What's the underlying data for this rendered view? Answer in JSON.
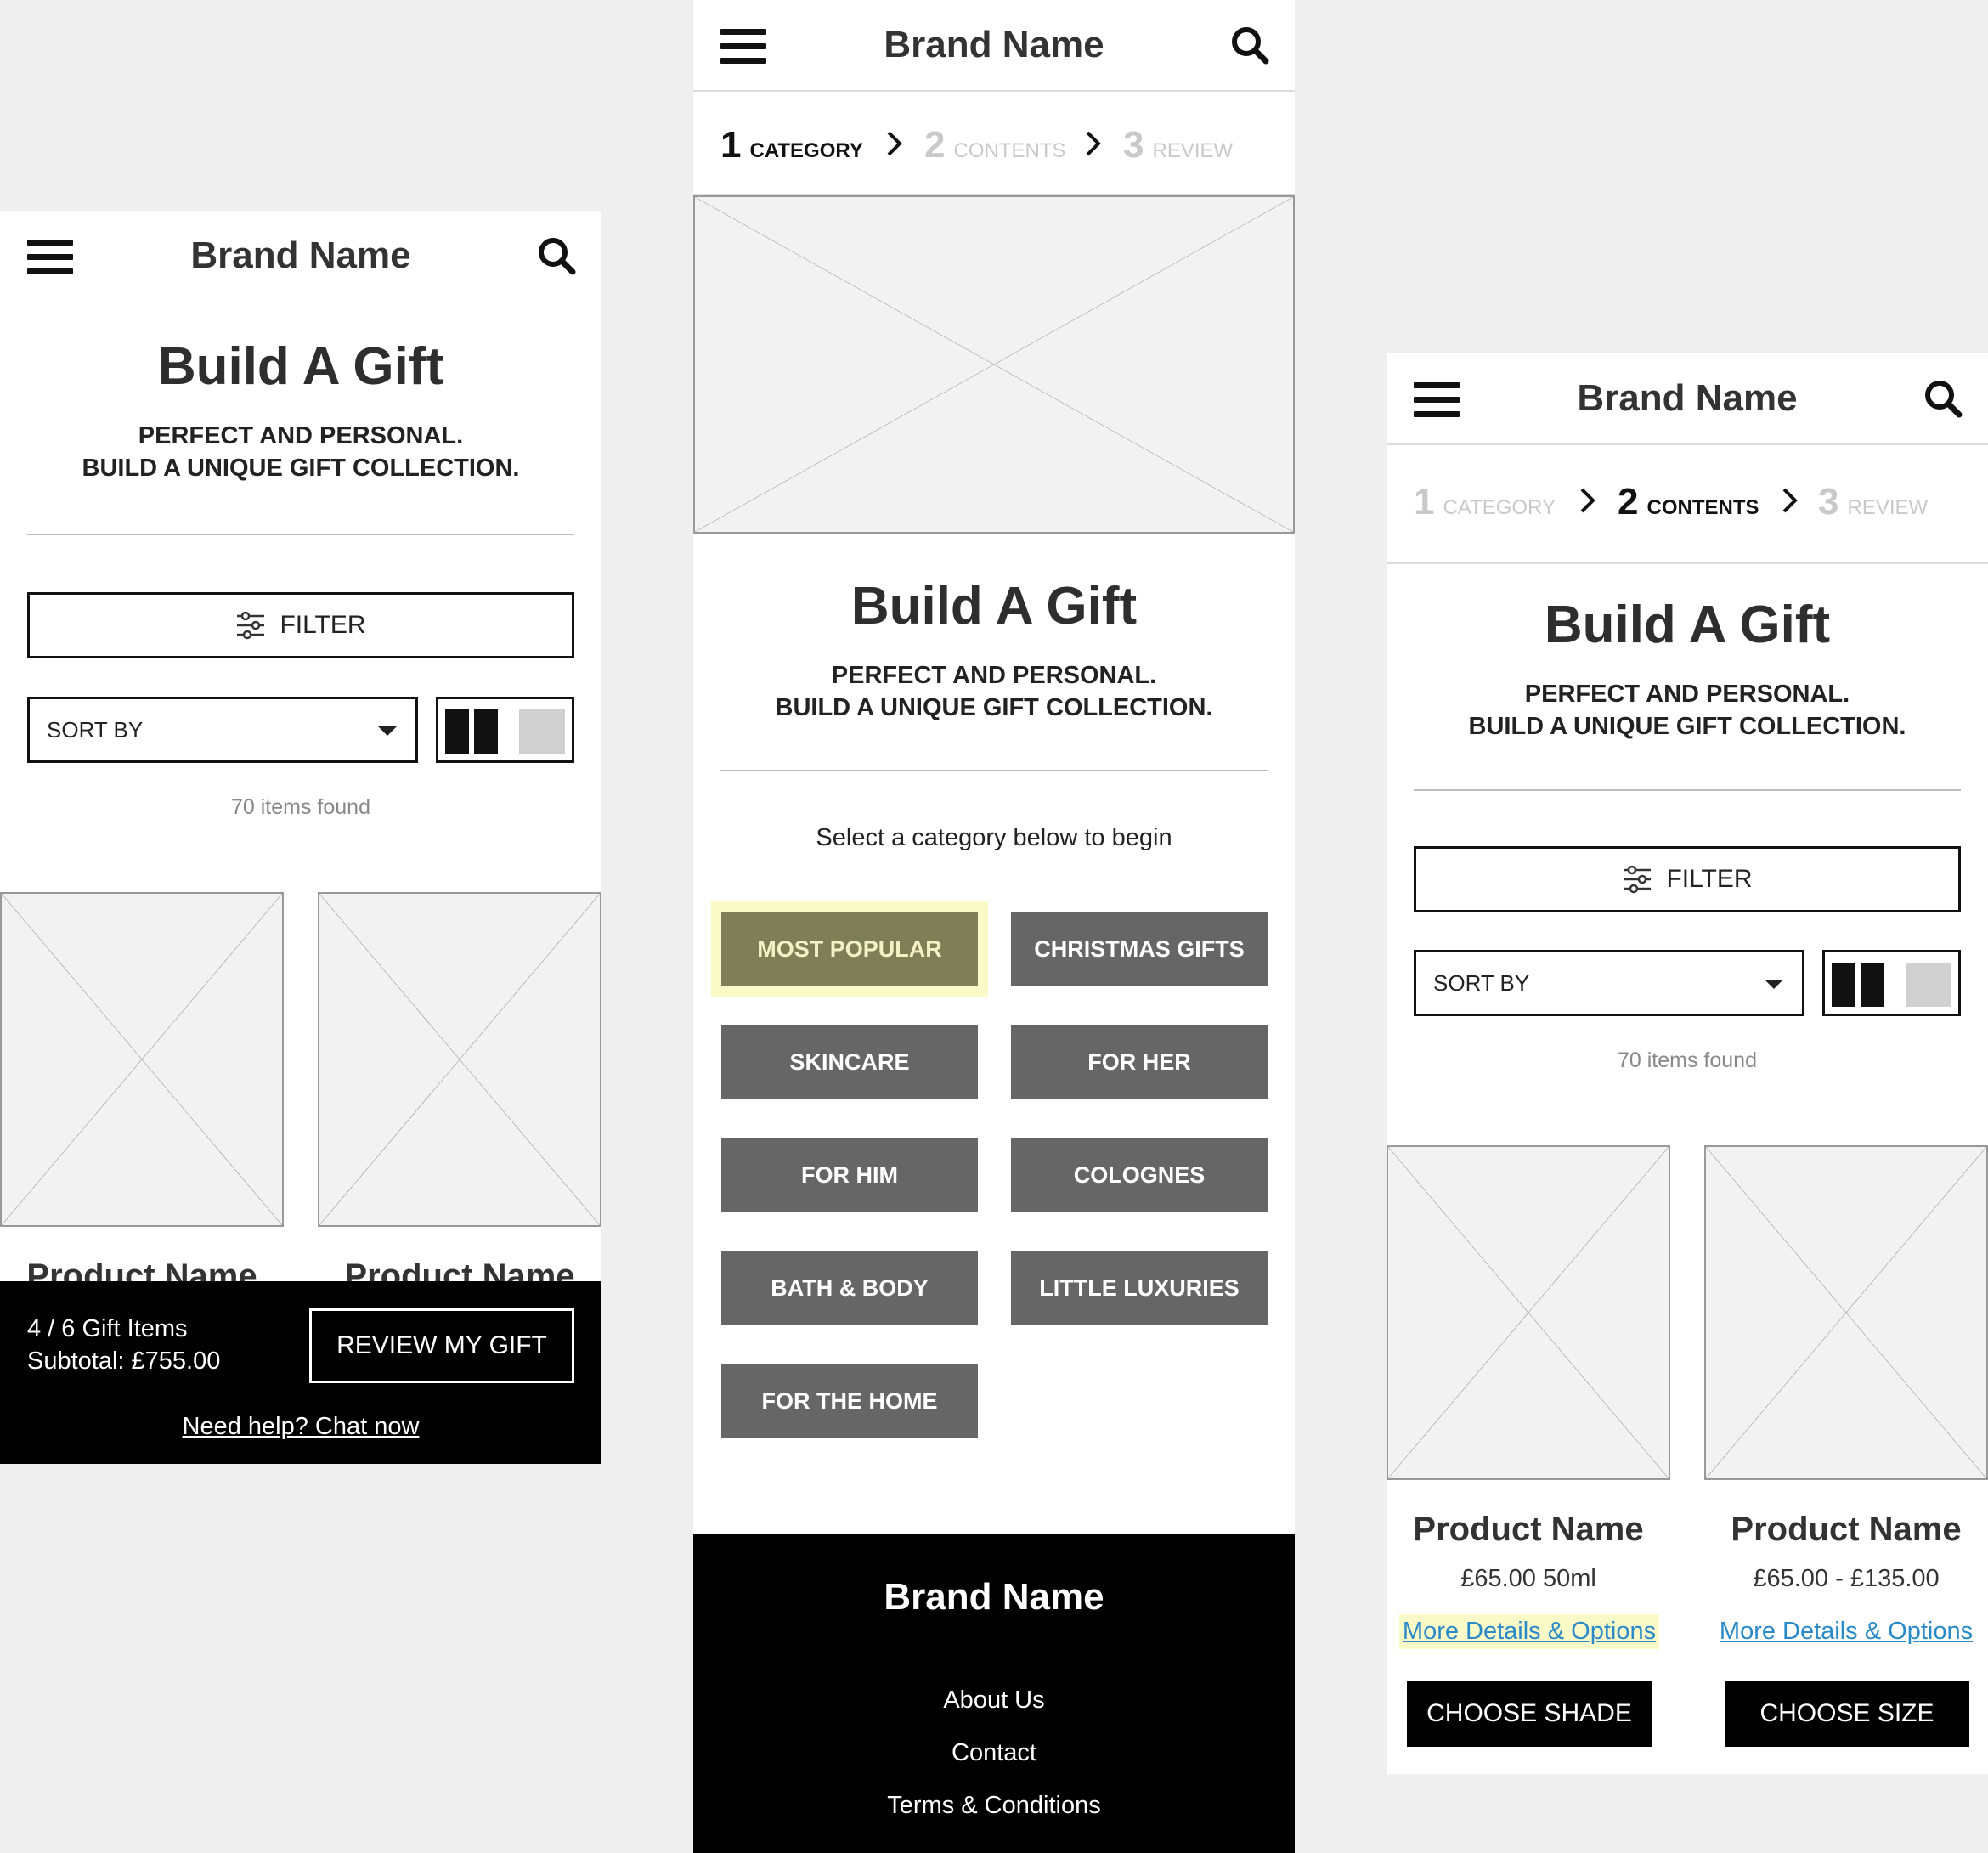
{
  "header": {
    "brand": "Brand Name"
  },
  "hero": {
    "title": "Build A Gift",
    "line1": "PERFECT AND PERSONAL.",
    "line2": "BUILD A UNIQUE GIFT COLLECTION."
  },
  "steps": [
    {
      "num": "1",
      "label": "CATEGORY"
    },
    {
      "num": "2",
      "label": "CONTENTS"
    },
    {
      "num": "3",
      "label": "REVIEW"
    }
  ],
  "toolbar": {
    "filter_label": "FILTER",
    "sort_label": "SORT BY",
    "items_found": "70 items found"
  },
  "products": [
    {
      "name": "Product Name",
      "price": "£65.00 50ml",
      "link": "More Details & Options",
      "action": "CHOOSE SHADE"
    },
    {
      "name": "Product Name",
      "price": "£65.00 - £135.00",
      "link": "More Details & Options",
      "action": "CHOOSE SIZE"
    }
  ],
  "gift_bar": {
    "items": "4 / 6 Gift Items",
    "subtotal": "Subtotal: £755.00",
    "review_button": "REVIEW MY GIFT",
    "help_link": "Need help? Chat now"
  },
  "categories": {
    "prompt": "Select a category below to begin",
    "items": [
      "MOST POPULAR",
      "CHRISTMAS GIFTS",
      "SKINCARE",
      "FOR HER",
      "FOR HIM",
      "COLOGNES",
      "BATH & BODY",
      "LITTLE LUXURIES",
      "FOR THE HOME"
    ],
    "selected": "MOST POPULAR"
  },
  "footer": {
    "brand": "Brand Name",
    "links": [
      "About Us",
      "Contact",
      "Terms & Conditions"
    ]
  },
  "colors": {
    "selected_category_bg": "#7f7f57",
    "highlight": "#fafac8",
    "category_bg": "#666666",
    "link": "#2a8ac8"
  },
  "icons": [
    "hamburger-menu-icon",
    "search-icon",
    "chevron-right-icon",
    "filter-sliders-icon",
    "caret-down-icon",
    "grid-view-icon",
    "list-view-icon",
    "image-placeholder-icon"
  ]
}
